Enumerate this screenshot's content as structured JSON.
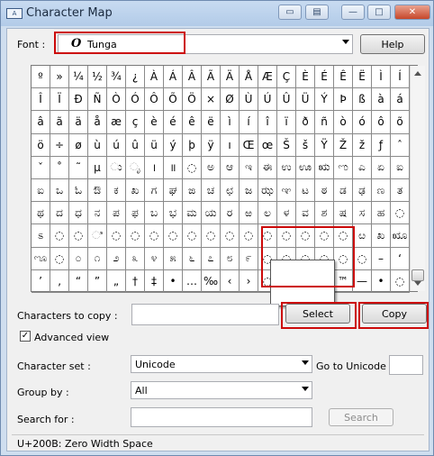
{
  "window": {
    "title": "Character Map",
    "app_icon": "character-map-icon"
  },
  "font_row": {
    "label": "Font :",
    "selected_font": "Tunga",
    "font_glyph": "O",
    "help_label": "Help"
  },
  "grid": {
    "rows": [
      [
        "º",
        "»",
        "¼",
        "½",
        "¾",
        "¿",
        "À",
        "Á",
        "Â",
        "Ã",
        "Ä",
        "Å",
        "Æ",
        "Ç",
        "È",
        "É",
        "Ê",
        "Ë",
        "Ì",
        "Í"
      ],
      [
        "Î",
        "Ï",
        "Ð",
        "Ñ",
        "Ò",
        "Ó",
        "Ô",
        "Õ",
        "Ö",
        "×",
        "Ø",
        "Ù",
        "Ú",
        "Û",
        "Ü",
        "Ý",
        "Þ",
        "ß",
        "à",
        "á"
      ],
      [
        "â",
        "ã",
        "ä",
        "å",
        "æ",
        "ç",
        "è",
        "é",
        "ê",
        "ë",
        "ì",
        "í",
        "î",
        "ï",
        "ð",
        "ñ",
        "ò",
        "ó",
        "ô",
        "õ"
      ],
      [
        "ö",
        "÷",
        "ø",
        "ù",
        "ú",
        "û",
        "ü",
        "ý",
        "þ",
        "ÿ",
        "ı",
        "Œ",
        "œ",
        "Š",
        "š",
        "Ÿ",
        "Ž",
        "ž",
        "ƒ",
        "ˆ"
      ],
      [
        "ˇ",
        "˚",
        "˜",
        "µ",
        "◌ು",
        "◌ೃ",
        "।",
        "॥",
        "◌",
        "ಅ",
        "ಆ",
        "ಇ",
        "ಈ",
        "ಉ",
        "ಊ",
        "ಋ",
        "ಌ",
        "ಎ",
        "ಏ",
        "ಐ"
      ],
      [
        "ಐ",
        "ಒ",
        "ಓ",
        "ಔ",
        "ಕ",
        "ಖ",
        "ಗ",
        "ಘ",
        "ಙ",
        "ಚ",
        "ಛ",
        "ಜ",
        "ಝ",
        "ಞ",
        "ಟ",
        "ಠ",
        "ಡ",
        "ಢ",
        "ಣ",
        "ತ"
      ],
      [
        "ಥ",
        "ದ",
        "ಧ",
        "ನ",
        "ಪ",
        "ಫ",
        "ಬ",
        "ಭ",
        "ಮ",
        "ಯ",
        "ರ",
        "ಱ",
        "ಲ",
        "ಳ",
        "ವ",
        "ಶ",
        "ಷ",
        "ಸ",
        "ಹ",
        "◌"
      ],
      [
        "ಽ",
        "◌",
        "◌",
        "◌ಿ",
        "◌",
        "◌",
        "◌",
        "◌",
        "◌",
        "◌",
        "◌",
        "◌",
        "◌",
        "◌",
        "◌",
        "◌",
        "◌",
        "ೞ",
        "ಖ",
        "ೠ"
      ],
      [
        "ೡ",
        "◌",
        "೦",
        "೧",
        "೨",
        "೩",
        "೪",
        "೫",
        "೬",
        "೭",
        "೮",
        "೯",
        "◌",
        "◌",
        "◌",
        "◌",
        "◌",
        "◌",
        "–",
        "‘"
      ],
      [
        "’",
        "‚",
        "“",
        "”",
        "„",
        "†",
        "‡",
        "•",
        "…",
        "‰",
        "‹",
        "›",
        "◌",
        "◌",
        "◌",
        "◌",
        "™",
        "—",
        "•",
        "◌"
      ]
    ]
  },
  "copy_row": {
    "label": "Characters to copy :",
    "value": "",
    "select_label": "Select",
    "copy_label": "Copy"
  },
  "advanced": {
    "label": "Advanced view",
    "checked": "✓"
  },
  "charset": {
    "label": "Character set :",
    "value": "Unicode",
    "goto_label": "Go to Unicode :",
    "goto_value": ""
  },
  "groupby": {
    "label": "Group by :",
    "value": "All"
  },
  "search": {
    "label": "Search for :",
    "value": "",
    "button_label": "Search"
  },
  "status": {
    "text": "U+200B: Zero Width Space"
  }
}
